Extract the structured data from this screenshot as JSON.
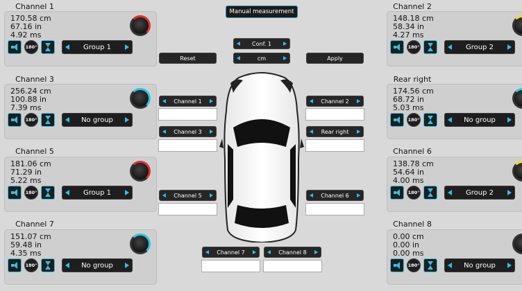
{
  "header": {
    "manual_measurement": "Manual measurement"
  },
  "controls": {
    "config": "Conf. 1",
    "unit": "cm",
    "reset": "Reset",
    "apply": "Apply"
  },
  "center_buttons": {
    "channel1": "Channel 1",
    "channel2": "Channel 2",
    "channel3": "Channel 3",
    "rear_right": "Rear right",
    "channel5": "Channel 5",
    "channel6": "Channel 6",
    "channel7": "Channel 7",
    "channel8": "Channel 8"
  },
  "channels": [
    {
      "title": "Channel 1",
      "cm": "170.58 cm",
      "in": "67.16 in",
      "ms": "4.92 ms",
      "group": "Group 1",
      "knob_color": "#e0302f",
      "rot": "180°"
    },
    {
      "title": "Channel 2",
      "cm": "148.18 cm",
      "in": "58.34 in",
      "ms": "4.27 ms",
      "group": "Group 2",
      "knob_color": "#f3dc21",
      "rot": "180°"
    },
    {
      "title": "Channel 3",
      "cm": "256.24 cm",
      "in": "100.88 in",
      "ms": "7.39 ms",
      "group": "No group",
      "knob_color": "#27c6e0",
      "rot": "180°"
    },
    {
      "title": "Rear right",
      "cm": "174.56 cm",
      "in": "68.72 in",
      "ms": "5.03 ms",
      "group": "No group",
      "knob_color": "#27c6e0",
      "rot": "180°"
    },
    {
      "title": "Channel 5",
      "cm": "181.06 cm",
      "in": "71.29 in",
      "ms": "5.22 ms",
      "group": "Group 1",
      "knob_color": "#e0302f",
      "rot": "180°"
    },
    {
      "title": "Channel 6",
      "cm": "138.78 cm",
      "in": "54.64 in",
      "ms": "4.00 ms",
      "group": "Group 2",
      "knob_color": "#f3dc21",
      "rot": "180°"
    },
    {
      "title": "Channel 7",
      "cm": "151.07 cm",
      "in": "59.48 in",
      "ms": "4.35 ms",
      "group": "No group",
      "knob_color": "#27c6e0",
      "rot": "180°"
    },
    {
      "title": "Channel 8",
      "cm": "0.00 cm",
      "in": "0.00 in",
      "ms": "0.00 ms",
      "group": "No group",
      "knob_color": "#333333",
      "rot": "180°"
    }
  ]
}
